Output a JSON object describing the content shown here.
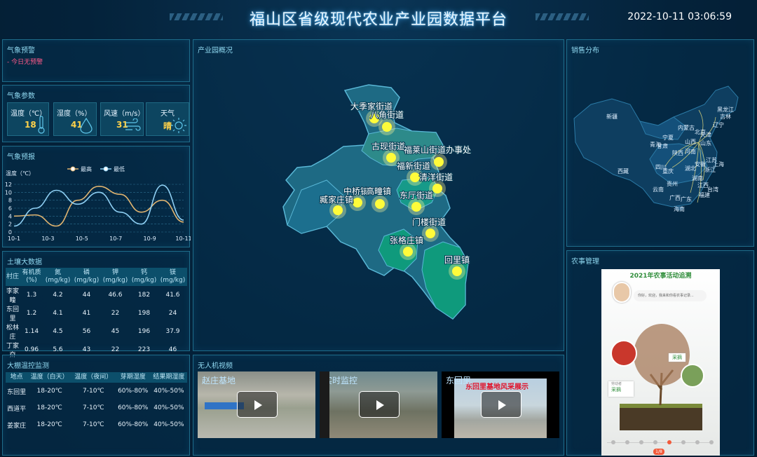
{
  "header": {
    "title": "福山区省级现代农业产业园数据平台",
    "datetime": "2022-10-11 03:06:59"
  },
  "weather_warning": {
    "title": "气象预警",
    "text": "- 今日无预警"
  },
  "weather_params": {
    "title": "气象参数",
    "cards": [
      {
        "label": "温度（℃）",
        "value": "18",
        "icon": "thermometer-icon"
      },
      {
        "label": "湿度（%）",
        "value": "41",
        "icon": "droplet-icon"
      },
      {
        "label": "风速（m/s）",
        "value": "31",
        "icon": "wind-icon"
      },
      {
        "label": "天气",
        "value": "晴",
        "icon": "sun-icon"
      }
    ]
  },
  "forecast": {
    "title": "气象预报",
    "legend_high": "最高",
    "legend_low": "最低",
    "unit": "温度（℃）"
  },
  "chart_data": {
    "type": "line",
    "categories": [
      "10-1",
      "10-3",
      "10-5",
      "10-7",
      "10-9",
      "10-11"
    ],
    "series": [
      {
        "name": "最高",
        "values": [
          4,
          4.3,
          1.5,
          8,
          11.5,
          9.5,
          5,
          8,
          2.5
        ]
      },
      {
        "name": "最低",
        "values": [
          1.5,
          6,
          10.5,
          7,
          10,
          5,
          2,
          11.8,
          3
        ]
      }
    ],
    "ylim": [
      0,
      12
    ],
    "yticks": [
      0,
      2,
      4,
      6,
      8,
      10,
      12
    ],
    "ylabel": "温度（℃）"
  },
  "soil": {
    "title": "土壤大数据",
    "headers": [
      "村庄",
      "有机质(%)",
      "氮(mg/kg)",
      "磷(mg/kg)",
      "钾(mg/kg)",
      "钙(mg/kg)",
      "镁(mg/kg)"
    ],
    "rows": [
      [
        "李家疃",
        "1.3",
        "4.2",
        "44",
        "46.6",
        "182",
        "41.6"
      ],
      [
        "东回里",
        "1.2",
        "4.1",
        "41",
        "22",
        "198",
        "24"
      ],
      [
        "松林庄",
        "1.14",
        "4.5",
        "56",
        "45",
        "196",
        "37.9"
      ],
      [
        "丁家夼",
        "0.96",
        "5.6",
        "43",
        "22",
        "223",
        "46"
      ]
    ]
  },
  "greenhouse": {
    "title": "大棚温控监测",
    "headers": [
      "地点",
      "温度（白天）",
      "温度（夜间）",
      "芽期湿度",
      "结果期湿度"
    ],
    "rows": [
      [
        "东回里",
        "18-20℃",
        "7-10℃",
        "60%-80%",
        "40%-50%"
      ],
      [
        "西道平",
        "18-20℃",
        "7-10℃",
        "60%-80%",
        "40%-50%"
      ],
      [
        "姜家庄",
        "18-20℃",
        "7-10℃",
        "60%-80%",
        "40%-50%"
      ]
    ]
  },
  "park": {
    "title": "产业园概况",
    "markers": [
      "大季家街道",
      "八角街道",
      "古现街道",
      "福莱山街道办事处",
      "福新街道",
      "清洋街道",
      "中桥镇",
      "高疃镇",
      "臧家庄镇",
      "东厅街道",
      "门楼街道",
      "张格庄镇",
      "回里镇"
    ]
  },
  "video": {
    "title": "无人机视频",
    "items": [
      {
        "label": "赵庄基地"
      },
      {
        "label": "实时监控"
      },
      {
        "label": "东回里",
        "banner": "东回里基地风采展示"
      }
    ]
  },
  "sales": {
    "title": "销售分布",
    "provinces": [
      "新疆",
      "黑龙江",
      "吉林",
      "辽宁",
      "内蒙古",
      "北京",
      "天津",
      "宁夏",
      "青海",
      "山西",
      "甘肃",
      "陕西",
      "河南",
      "山东",
      "西藏",
      "四川",
      "重庆",
      "湖北",
      "安徽",
      "江苏",
      "上海",
      "浙江",
      "贵州",
      "湖南",
      "江西",
      "福建",
      "云南",
      "广西",
      "广东",
      "台湾",
      "海南"
    ]
  },
  "farm": {
    "title": "农事管理",
    "poster_title": "2021年农事活动追溯",
    "bubble": "你好，欢迎，我来和你看农事记录...",
    "tag1": "采摘",
    "tag2": "采摘",
    "tag2_sub": "劳动者",
    "page_badge": "1/8"
  }
}
